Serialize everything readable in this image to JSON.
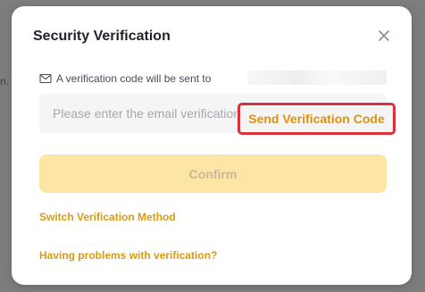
{
  "backdrop": {
    "fragment_text": "n."
  },
  "modal": {
    "title": "Security Verification",
    "close_icon": "close-icon",
    "info_text": "A verification code will be sent to",
    "info_icon": "mail-icon",
    "email_input": {
      "placeholder": "Please enter the email verification code",
      "value": ""
    },
    "send_code_label": "Send Verification Code",
    "confirm_label": "Confirm",
    "switch_method_label": "Switch Verification Method",
    "problems_label": "Having problems with verification?"
  },
  "colors": {
    "accent": "#D89B13",
    "confirm_disabled_bg": "#FCE5A5",
    "highlight_border": "#D8323F"
  }
}
